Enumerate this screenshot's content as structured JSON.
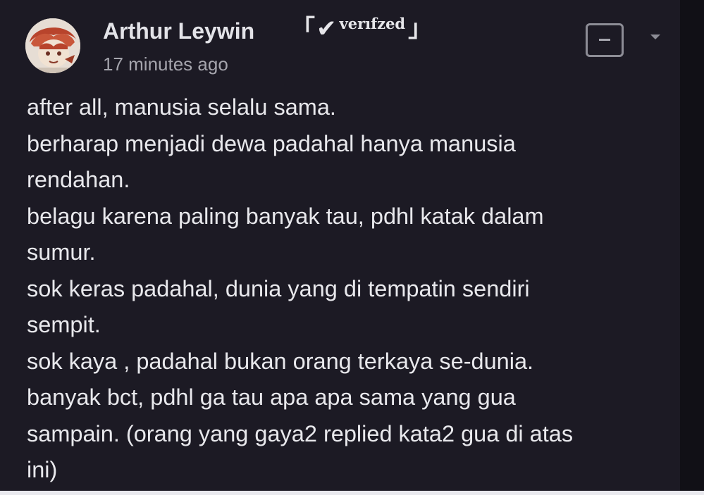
{
  "comment": {
    "author": "Arthur Leywin",
    "badge": {
      "left_bracket": "「",
      "check": "✔",
      "label": "verıfzed",
      "right_bracket": "」"
    },
    "timestamp": "17 minutes ago",
    "lines": [
      "after all, manusia selalu sama.",
      "berharap menjadi dewa padahal hanya manusia",
      "rendahan.",
      "belagu karena paling banyak tau, pdhl katak dalam",
      "sumur.",
      "sok keras padahal, dunia yang di tempatin sendiri",
      "sempit.",
      "sok kaya , padahal bukan orang terkaya se-dunia.",
      "banyak bct, pdhl ga tau apa apa sama yang gua",
      "sampain. (orang yang gaya2 replied kata2 gua di atas",
      "ini)"
    ]
  },
  "icons": {
    "avatar": "avatar-anime-character",
    "menu": "minus-square-icon",
    "dropdown": "chevron-down-icon"
  },
  "colors": {
    "background": "#1c1a24",
    "text": "#e8e8ec",
    "muted": "#a5a5ad",
    "icon": "#8d8d96"
  }
}
